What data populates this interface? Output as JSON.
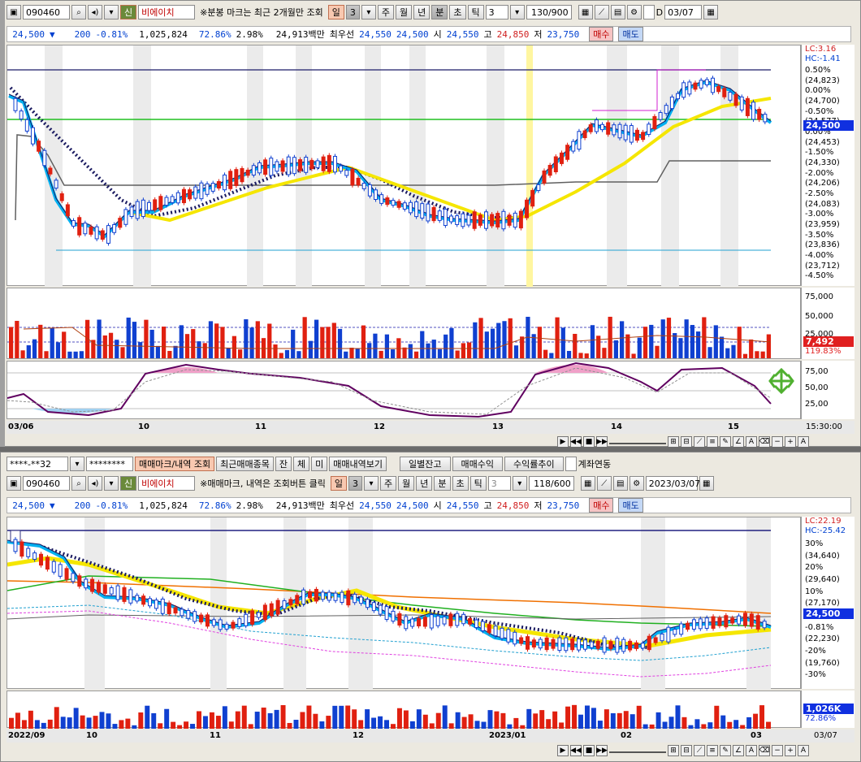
{
  "top": {
    "code": "090460",
    "badge": "신",
    "name": "비에이치",
    "note": "※분봉 마크는 최근 2개월만 조회",
    "periods": [
      "일",
      "3",
      "주",
      "월",
      "년",
      "분",
      "초",
      "틱"
    ],
    "interval": "3",
    "count": "130/900",
    "date": "03/07"
  },
  "quote": {
    "price": "24,500",
    "arrow": "▼",
    "change": "200",
    "rate": "-0.81%",
    "volume": "1,025,824",
    "vol_rate": "72.86%",
    "turnover": "2.98%",
    "amount": "24,913백만",
    "best_label": "최우선",
    "best_ask": "24,550",
    "best_bid": "24,500",
    "open_label": "시",
    "open": "24,550",
    "high": "24,850",
    "low_label": "저",
    "low": "23,750",
    "buy": "매수",
    "sell": "매도"
  },
  "top_chart": {
    "lc": "LC:3.16",
    "hc": "HC:-1.41",
    "yticks": [
      "0.50%",
      "(24,823)",
      "0.00%",
      "(24,700)",
      "-0.50%",
      "(24,577)",
      "0.00%",
      "(24,453)",
      "-1.50%",
      "(24,330)",
      "-2.00%",
      "(24,206)",
      "-2.50%",
      "(24,083)",
      "-3.00%",
      "(23,959)",
      "-3.50%",
      "(23,836)",
      "-4.00%",
      "(23,712)",
      "-4.50%"
    ],
    "current": "24,500",
    "vol_ticks": [
      "75,000",
      "50,000",
      "25,000"
    ],
    "vol_current": "7,492",
    "vol_rate": "119.83%",
    "osc_ticks": [
      "75,00",
      "50,00",
      "25,00"
    ],
    "xlabels": [
      "03/06",
      "10",
      "11",
      "12",
      "13",
      "14",
      "15"
    ],
    "time": "15:30:00"
  },
  "bottom_toolbar": {
    "account": "****-**32",
    "password": "********",
    "btn_mark": "매매마크/내역 조회",
    "btn_recent": "최근매매종목",
    "btn_a": "잔",
    "btn_b": "체",
    "btn_c": "미",
    "btn_history": "매매내역보기",
    "btn_daily": "일별잔고",
    "btn_profit": "매매수익",
    "btn_trend": "수익률추이",
    "link_label": "계좌연동"
  },
  "bottom": {
    "code": "090460",
    "badge": "신",
    "name": "비에이치",
    "note": "※매매마크, 내역은 조회버튼 클릭",
    "periods": [
      "일",
      "3",
      "주",
      "월",
      "년",
      "분",
      "초",
      "틱"
    ],
    "interval": "3",
    "count": "118/600",
    "date": "2023/03/07"
  },
  "bottom_chart": {
    "lc": "LC:22.19",
    "hc": "HC:-25.42",
    "yticks": [
      "30%",
      "(34,640)",
      "20%",
      "(29,640)",
      "10%",
      "(27,170)",
      "0%",
      "-0.81%",
      "(22,230)",
      "-20%",
      "(19,760)",
      "-30%"
    ],
    "current": "24,500",
    "vol_current": "1,026K",
    "vol_rate": "72.86%",
    "xlabels": [
      "2022/09",
      "10",
      "11",
      "12",
      "2023/01",
      "02",
      "03"
    ],
    "time": "03/07"
  },
  "colors": {
    "up": "#e02010",
    "down": "#1040d0",
    "ma_yellow": "#f5e600",
    "ma_cyan": "#00b0f0"
  },
  "chart_data": [
    {
      "type": "line",
      "title": "",
      "x": [
        "03/06",
        "10",
        "11",
        "12",
        "13",
        "14",
        "15"
      ],
      "series": [
        {
          "values": [
            24700,
            23950,
            24350,
            24120,
            23980,
            24600,
            24500
          ]
        }
      ],
      "ylim": [
        23712,
        24823
      ]
    },
    {
      "type": "line",
      "title": "",
      "x": [
        "2022/09",
        "10",
        "11",
        "12",
        "2023/01",
        "02",
        "03"
      ],
      "series": [
        {
          "values": [
            32110,
            27170,
            27170,
            24700,
            22230,
            23500,
            24500
          ]
        }
      ],
      "ylim": [
        19760,
        34640
      ]
    }
  ]
}
